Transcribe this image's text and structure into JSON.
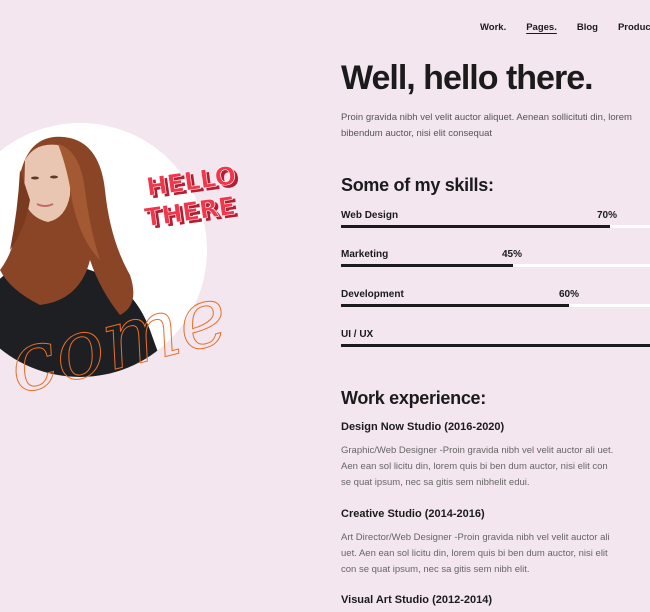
{
  "nav": {
    "items": [
      "Work.",
      "Pages.",
      "Blog",
      "Products"
    ],
    "active": "Pages."
  },
  "hero": {
    "sticker_lines": [
      "HELLO",
      "THERE"
    ],
    "outline_word": "come"
  },
  "intro": {
    "title": "Well, hello there.",
    "lines": [
      "Proin gravida nibh vel velit auctor aliquet. Aenean sollicituti din, lorem",
      "bibendum auctor, nisi elit consequat"
    ]
  },
  "skills": {
    "title": "Some of my skills:",
    "items": [
      {
        "name": "Web Design",
        "percent_label": "70%",
        "level": 0.815
      },
      {
        "name": "Marketing",
        "percent_label": "45%",
        "level": 0.52
      },
      {
        "name": "Development",
        "percent_label": "60%",
        "level": 0.69
      },
      {
        "name": "UI / UX",
        "percent_label": "",
        "level": 1.0
      }
    ]
  },
  "experience": {
    "title": "Work experience:",
    "jobs": [
      {
        "title": "Design Now Studio (2016-2020)",
        "desc": [
          "Graphic/Web Designer -Proin gravida nibh vel velit auctor ali uet.",
          "Aen ean sol licitu din, lorem quis bi ben dum auctor, nisi elit con",
          "se quat ipsum, nec sa gitis sem nibhelit edui."
        ]
      },
      {
        "title": "Creative Studio (2014-2016)",
        "desc": [
          "Art Director/Web Designer -Proin gravida nibh vel velit auctor ali",
          "uet. Aen ean sol licitu din, lorem quis bi ben dum auctor, nisi elit",
          "con se quat ipsum, nec sa gitis sem nibh elit."
        ]
      },
      {
        "title": "Visual Art Studio (2012-2014)",
        "desc": []
      }
    ]
  },
  "colors": {
    "background": "#f3e6ef",
    "text": "#1b1b1b",
    "accent": "#f0384d",
    "outline": "#e8702a",
    "track": "#ffffff"
  }
}
